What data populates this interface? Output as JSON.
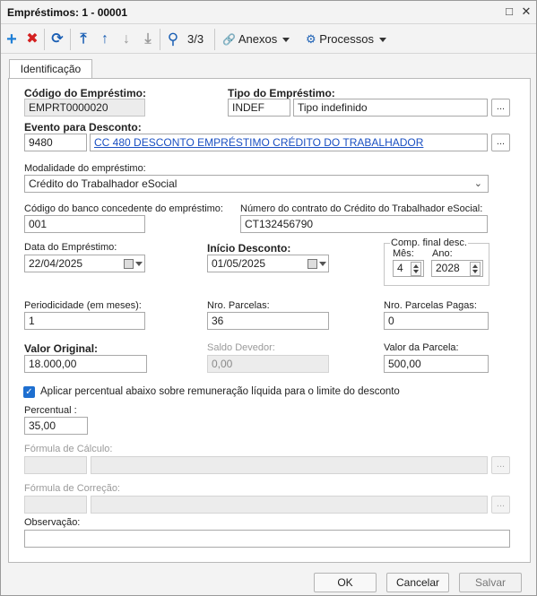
{
  "window": {
    "title": "Empréstimos: 1 - 00001",
    "restore_glyph": "□",
    "close_glyph": "✕"
  },
  "toolbar": {
    "add_icon": "+",
    "delete_icon": "✖",
    "refresh_icon": "⟳",
    "first_icon": "⤒",
    "prev_icon": "↑",
    "next_icon": "↓",
    "last_icon": "⤓",
    "search_icon": "⚲",
    "record_counter": "3/3",
    "attachments_icon": "🔗",
    "attachments_label": "Anexos",
    "processes_icon": "⚙",
    "processes_label": "Processos"
  },
  "tabs": [
    {
      "label": "Identificação",
      "active": true
    }
  ],
  "form": {
    "codigo_emprestimo": {
      "label": "Código do Empréstimo:",
      "value": "EMPRT0000020"
    },
    "tipo_emprestimo": {
      "label": "Tipo do Empréstimo:",
      "code": "INDEF",
      "description": "Tipo indefinido",
      "lookup": "..."
    },
    "evento_desconto": {
      "label": "Evento para Desconto:",
      "code": "9480",
      "description": "CC 480 DESCONTO EMPRÉSTIMO CRÉDITO DO TRABALHADOR",
      "lookup": "..."
    },
    "modalidade": {
      "label": "Modalidade do empréstimo:",
      "value": "Crédito do Trabalhador eSocial"
    },
    "codigo_banco": {
      "label": "Código do banco concedente do empréstimo:",
      "value": "001"
    },
    "numero_contrato": {
      "label": "Número do contrato do Crédito do Trabalhador eSocial:",
      "value": "CT132456790"
    },
    "data_emprestimo": {
      "label": "Data do Empréstimo:",
      "value": "22/04/2025"
    },
    "inicio_desconto": {
      "label": "Início Desconto:",
      "value": "01/05/2025"
    },
    "comp_final": {
      "label": "Comp. final desc.",
      "mes_label": "Mês:",
      "mes": "4",
      "ano_label": "Ano:",
      "ano": "2028"
    },
    "periodicidade": {
      "label": "Periodicidade (em meses):",
      "value": "1"
    },
    "nro_parcelas": {
      "label": "Nro. Parcelas:",
      "value": "36"
    },
    "nro_parcelas_pagas": {
      "label": "Nro. Parcelas Pagas:",
      "value": "0"
    },
    "valor_original": {
      "label": "Valor Original:",
      "value": "18.000,00"
    },
    "saldo_devedor": {
      "label": "Saldo Devedor:",
      "value": "0,00"
    },
    "valor_parcela": {
      "label": "Valor da Parcela:",
      "value": "500,00"
    },
    "aplicar_percentual": {
      "label": "Aplicar percentual abaixo sobre remuneração líquida para o limite do desconto",
      "checked": true
    },
    "percentual": {
      "label": "Percentual :",
      "value": "35,00"
    },
    "formula_calculo": {
      "label": "Fórmula de Cálculo:",
      "lookup": "..."
    },
    "formula_correcao": {
      "label": "Fórmula de Correção:",
      "lookup": "..."
    },
    "observacao": {
      "label": "Observação:",
      "value": ""
    }
  },
  "footer": {
    "ok": "OK",
    "cancel": "Cancelar",
    "save": "Salvar"
  },
  "colors": {
    "accent": "#1e6fd0",
    "add": "#1f7fd6",
    "delete": "#d42020",
    "link": "#1a4fc2"
  }
}
